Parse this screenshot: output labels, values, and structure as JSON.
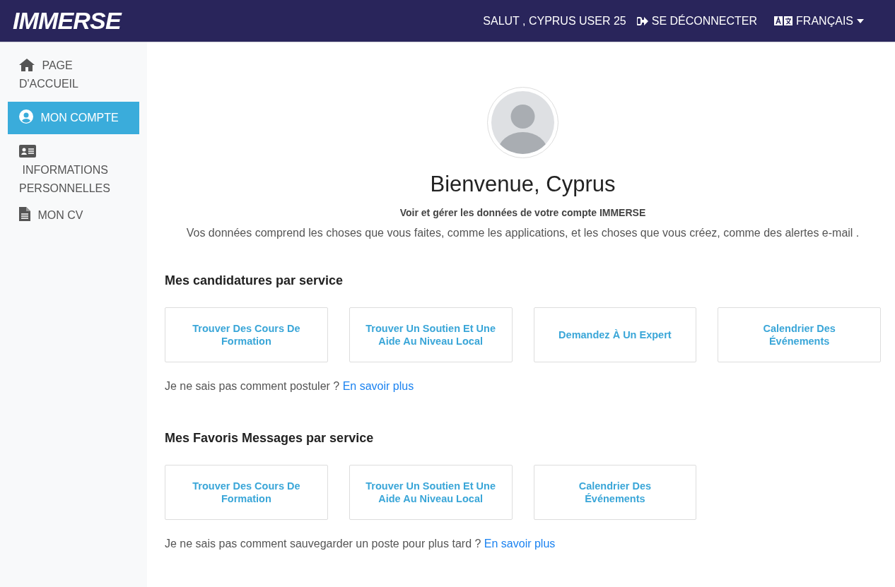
{
  "header": {
    "logo": "IMMERSE",
    "greeting": "SALUT , CYPRUS USER 25",
    "logout": "SE DÉCONNECTER",
    "language": "FRANÇAIS"
  },
  "sidebar": {
    "items": [
      {
        "kind": "home",
        "label": "PAGE D'ACCUEIL",
        "selected": false
      },
      {
        "kind": "account",
        "label": "MON COMPTE",
        "selected": true
      },
      {
        "kind": "id-card",
        "label": " INFORMATIONS PERSONNELLES",
        "selected": false
      },
      {
        "kind": "document",
        "label": "MON CV",
        "selected": false
      }
    ]
  },
  "profile": {
    "title": "Bienvenue, Cyprus",
    "subtitle": "Voir et gérer les données de votre compte IMMERSE",
    "description": "Vos données comprend les choses que vous faites, comme les applications, et les choses que vous créez, comme des alertes e-mail ."
  },
  "sections": [
    {
      "heading": "Mes candidatures par service",
      "cards": [
        "Trouver Des Cours De Formation",
        "Trouver Un Soutien Et Une Aide Au Niveau Local",
        "Demandez À Un Expert",
        "Calendrier Des Événements"
      ],
      "note": "Je ne sais pas comment postuler ?",
      "link": "En savoir plus"
    },
    {
      "heading": "Mes Favoris Messages par service",
      "cards": [
        "Trouver Des Cours De Formation",
        "Trouver Un Soutien Et Une Aide Au Niveau Local",
        "Calendrier Des Événements"
      ],
      "note": "Je ne sais pas comment sauvegarder un poste pour plus tard ?",
      "link": "En savoir plus"
    }
  ]
}
